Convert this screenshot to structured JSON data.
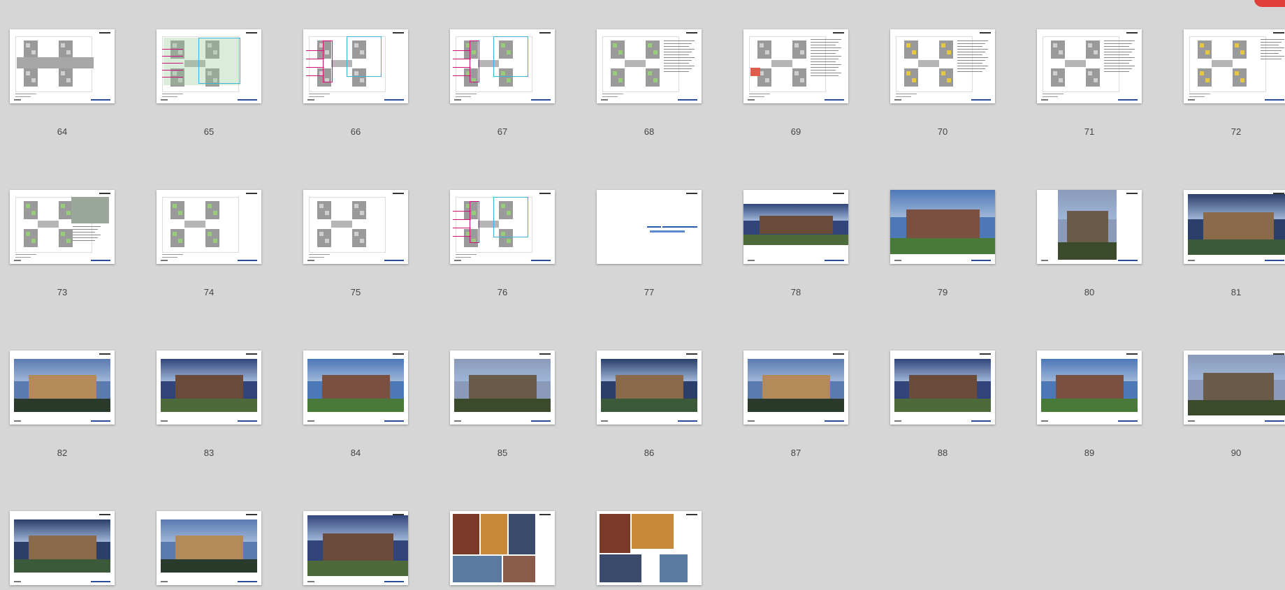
{
  "viewer": {
    "colors": {
      "background": "#d6d6d6",
      "page": "#ffffff",
      "label": "#444444",
      "badge": "#e0403a"
    },
    "thumbnails": [
      {
        "page": "64",
        "type": "plan-gray"
      },
      {
        "page": "65",
        "type": "plan-color"
      },
      {
        "page": "66",
        "type": "plan-pink"
      },
      {
        "page": "67",
        "type": "plan-green-blue"
      },
      {
        "page": "68",
        "type": "plan-text-green"
      },
      {
        "page": "69",
        "type": "plan-small-red"
      },
      {
        "page": "70",
        "type": "plan-yellow"
      },
      {
        "page": "71",
        "type": "plan-text"
      },
      {
        "page": "72",
        "type": "plan-yellow-small"
      },
      {
        "page": "73",
        "type": "plan-green-legend"
      },
      {
        "page": "74",
        "type": "plan-green"
      },
      {
        "page": "75",
        "type": "plan-gray-symmetric"
      },
      {
        "page": "76",
        "type": "plan-green-blue"
      },
      {
        "page": "77",
        "type": "title-blank"
      },
      {
        "page": "78",
        "type": "photo-wide"
      },
      {
        "page": "79",
        "type": "photo-full"
      },
      {
        "page": "80",
        "type": "photo-narrow"
      },
      {
        "page": "81",
        "type": "photo-bleed"
      },
      {
        "page": "82",
        "type": "photo"
      },
      {
        "page": "83",
        "type": "photo"
      },
      {
        "page": "84",
        "type": "photo"
      },
      {
        "page": "85",
        "type": "photo"
      },
      {
        "page": "86",
        "type": "photo"
      },
      {
        "page": "87",
        "type": "photo"
      },
      {
        "page": "88",
        "type": "photo"
      },
      {
        "page": "89",
        "type": "photo"
      },
      {
        "page": "90",
        "type": "photo-bleed"
      },
      {
        "page": "",
        "type": "photo"
      },
      {
        "page": "",
        "type": "photo"
      },
      {
        "page": "",
        "type": "photo-bleed"
      },
      {
        "page": "",
        "type": "collage"
      },
      {
        "page": "",
        "type": "collage"
      }
    ]
  }
}
